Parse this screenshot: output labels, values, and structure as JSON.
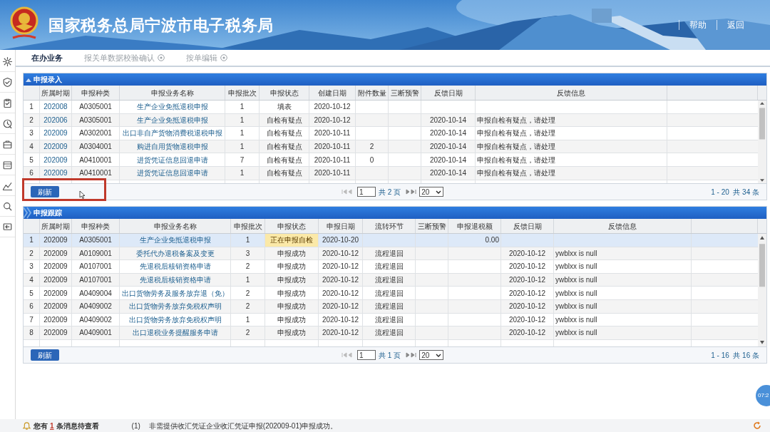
{
  "header": {
    "title": "国家税务总局宁波市电子税务局",
    "links": [
      "帮助",
      "返回"
    ]
  },
  "tabs": [
    {
      "label": "在办业务",
      "selected": true,
      "closable": false
    },
    {
      "label": "报关单数据校验确认",
      "selected": false,
      "closable": true
    },
    {
      "label": "按单编辑",
      "selected": false,
      "closable": true
    }
  ],
  "panels": [
    {
      "title": "申报录入",
      "collapsible": true,
      "highlighted": true,
      "columns": [
        "所属时期",
        "申报种类",
        "申报业务名称",
        "申报批次",
        "申报状态",
        "创建日期",
        "附件数量",
        "三断预警",
        "反馈日期",
        "反馈信息"
      ],
      "rows": [
        {
          "no": "1",
          "selected": false,
          "flagged": false,
          "cells": [
            "202008",
            "A0305001",
            "生产企业免抵退税申报",
            "1",
            "填表",
            "2020-10-12",
            null,
            null,
            null,
            null
          ]
        },
        {
          "no": "2",
          "selected": false,
          "flagged": false,
          "cells": [
            "202006",
            "A0305001",
            "生产企业免抵退税申报",
            "1",
            "自检有疑点",
            "2020-10-12",
            null,
            null,
            "2020-10-14",
            "申报自检有疑点，请处理"
          ]
        },
        {
          "no": "3",
          "selected": false,
          "flagged": false,
          "cells": [
            "202009",
            "A0302001",
            "出口非自产货物消费税退税申报",
            "1",
            "自检有疑点",
            "2020-10-11",
            null,
            null,
            "2020-10-14",
            "申报自检有疑点，请处理"
          ]
        },
        {
          "no": "4",
          "selected": false,
          "flagged": false,
          "cells": [
            "202009",
            "A0304001",
            "购进自用货物退税申报",
            "1",
            "自检有疑点",
            "2020-10-11",
            "2",
            null,
            "2020-10-14",
            "申报自检有疑点，请处理"
          ]
        },
        {
          "no": "5",
          "selected": false,
          "flagged": false,
          "cells": [
            "202009",
            "A0410001",
            "进货凭证信息回退申请",
            "7",
            "自检有疑点",
            "2020-10-11",
            "0",
            null,
            "2020-10-14",
            "申报自检有疑点，请处理"
          ]
        },
        {
          "no": "6",
          "selected": false,
          "flagged": false,
          "cells": [
            "202009",
            "A0410001",
            "进货凭证信息回退申请",
            "1",
            "自检有疑点",
            "2020-10-11",
            null,
            null,
            "2020-10-14",
            "申报自检有疑点，请处理"
          ]
        }
      ],
      "refresh_button": "刷新",
      "pager": {
        "page": "1",
        "total_pages": "共 2 页",
        "page_size": "20",
        "summary": "1 - 20  共 34 条"
      }
    },
    {
      "title": "申报跟踪",
      "collapsible": false,
      "highlighted": false,
      "columns": [
        "所属时期",
        "申报种类",
        "申报业务名称",
        "申报批次",
        "申报状态",
        "申报日期",
        "流转环节",
        "三断预警",
        "申报退税额",
        "反馈日期",
        "反馈信息"
      ],
      "rows": [
        {
          "no": "1",
          "selected": true,
          "flagged": true,
          "cells": [
            "202009",
            "A0305001",
            "生产企业免抵退税申报",
            "1",
            "正在申报自检",
            "2020-10-20",
            null,
            null,
            "0.00",
            null,
            null
          ]
        },
        {
          "no": "2",
          "selected": false,
          "flagged": false,
          "cells": [
            "202009",
            "A0109001",
            "委托代办退税备案及变更",
            "3",
            "申报成功",
            "2020-10-12",
            "流程退回",
            null,
            null,
            "2020-10-12",
            "ywblxx is null"
          ]
        },
        {
          "no": "3",
          "selected": false,
          "flagged": false,
          "cells": [
            "202009",
            "A0107001",
            "先退税后核销资格申请",
            "2",
            "申报成功",
            "2020-10-12",
            "流程退回",
            null,
            null,
            "2020-10-12",
            "ywblxx is null"
          ]
        },
        {
          "no": "4",
          "selected": false,
          "flagged": false,
          "cells": [
            "202009",
            "A0107001",
            "先退税后核销资格申请",
            "1",
            "申报成功",
            "2020-10-12",
            "流程退回",
            null,
            null,
            "2020-10-12",
            "ywblxx is null"
          ]
        },
        {
          "no": "5",
          "selected": false,
          "flagged": false,
          "cells": [
            "202009",
            "A0409004",
            "出口货物劳务及服务放弃退（免）",
            "2",
            "申报成功",
            "2020-10-12",
            "流程退回",
            null,
            null,
            "2020-10-12",
            "ywblxx is null"
          ]
        },
        {
          "no": "6",
          "selected": false,
          "flagged": false,
          "cells": [
            "202009",
            "A0409002",
            "出口货物劳务放弃免税权声明",
            "2",
            "申报成功",
            "2020-10-12",
            "流程退回",
            null,
            null,
            "2020-10-12",
            "ywblxx is null"
          ]
        },
        {
          "no": "7",
          "selected": false,
          "flagged": false,
          "cells": [
            "202009",
            "A0409002",
            "出口货物劳务放弃免税权声明",
            "1",
            "申报成功",
            "2020-10-12",
            "流程退回",
            null,
            null,
            "2020-10-12",
            "ywblxx is null"
          ]
        },
        {
          "no": "8",
          "selected": false,
          "flagged": false,
          "cells": [
            "202009",
            "A0409001",
            "出口退税业务提醒服务申请",
            "2",
            "申报成功",
            "2020-10-12",
            "流程退回",
            null,
            null,
            "2020-10-12",
            "ywblxx is null"
          ]
        }
      ],
      "refresh_button": "刷新",
      "pager": {
        "page": "1",
        "total_pages": "共 1 页",
        "page_size": "20",
        "summary": "1 - 16  共 16 条"
      }
    }
  ],
  "clock_badge": "07:2",
  "status_bar": {
    "notice_prefix": "您有",
    "notice_count": "1",
    "notice_suffix": "条消息待查看",
    "message_index": "(1)",
    "message": "非需提供收汇凭证企业收汇凭证申报(202009-01)申报成功。"
  }
}
